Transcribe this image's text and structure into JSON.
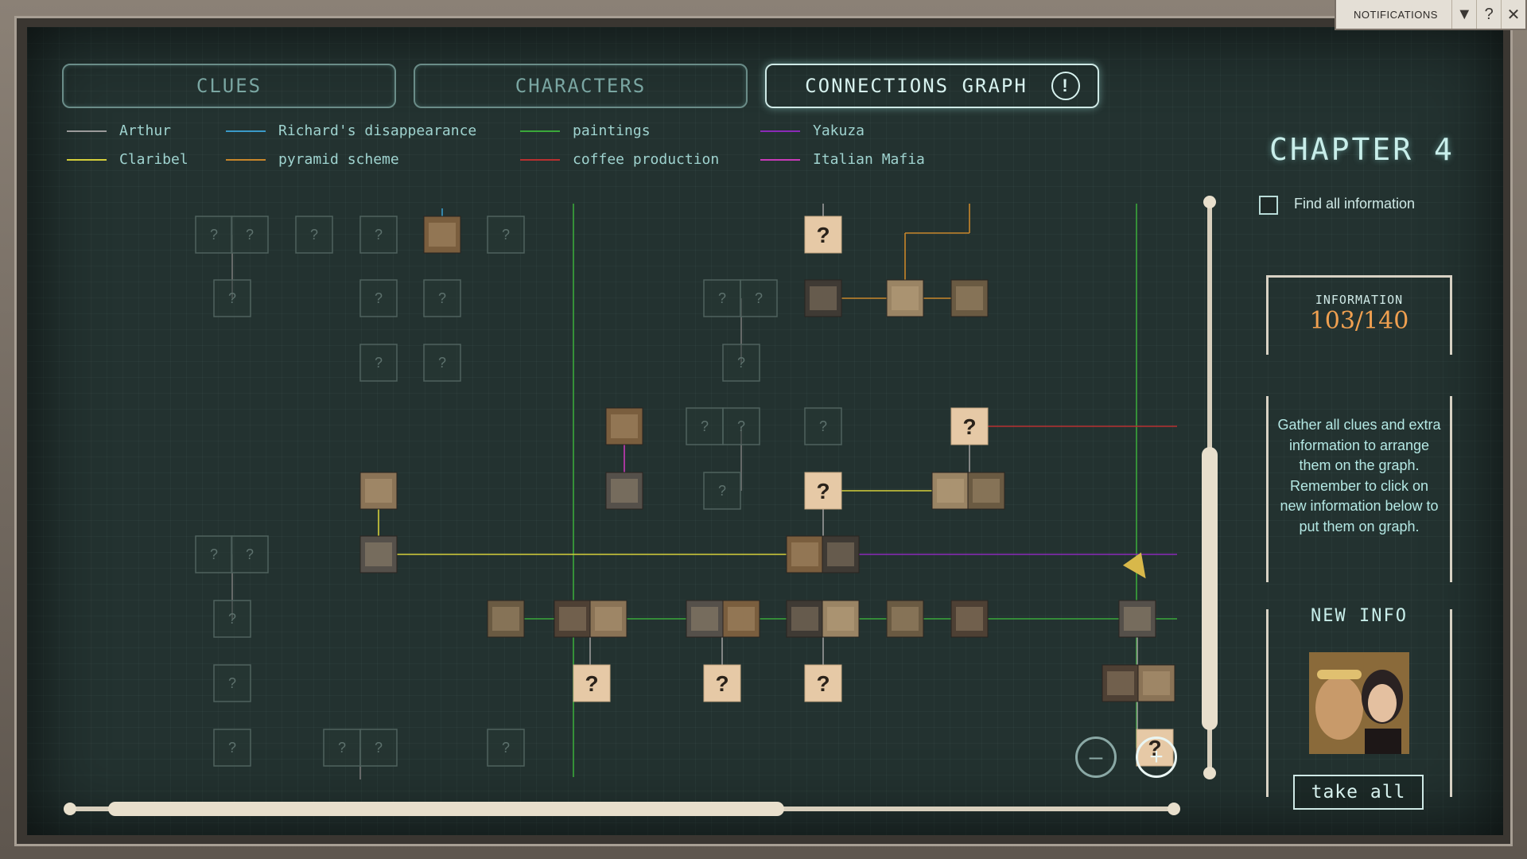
{
  "notifications": {
    "label": "NOTIFICATIONS",
    "dropdown_icon": "▼",
    "help_icon": "?",
    "close_icon": "✕"
  },
  "tabs": [
    {
      "label": "CLUES",
      "active": false
    },
    {
      "label": "CHARACTERS",
      "active": false
    },
    {
      "label": "CONNECTIONS GRAPH",
      "active": true,
      "badge": "!"
    }
  ],
  "legend": [
    {
      "label": "Arthur",
      "color": "#9a9a9a"
    },
    {
      "label": "Claribel",
      "color": "#d4cf3a"
    },
    {
      "label": "Richard's disappearance",
      "color": "#3a9ac8"
    },
    {
      "label": "pyramid scheme",
      "color": "#c8862a"
    },
    {
      "label": "paintings",
      "color": "#3aa83a"
    },
    {
      "label": "coffee production",
      "color": "#b83030"
    },
    {
      "label": "Yakuza",
      "color": "#8a2ab8"
    },
    {
      "label": "Italian Mafia",
      "color": "#c83ab8"
    }
  ],
  "chapter": "CHAPTER 4",
  "find_all": {
    "label": "Find all information",
    "checked": false
  },
  "information": {
    "title": "INFORMATION",
    "count": "103/140"
  },
  "hint": "Gather all clues and extra information to arrange them on the graph. Remember to click on new information below to put them on graph.",
  "new_info": {
    "title": "NEW INFO"
  },
  "take_all": "take all",
  "zoom": {
    "out": "–",
    "in": "+"
  },
  "graph": {
    "placeholder_glyph": "?",
    "nodes": [
      {
        "id": "a1",
        "type": "empty"
      },
      {
        "id": "a2",
        "type": "empty"
      },
      {
        "id": "a3",
        "type": "empty"
      },
      {
        "id": "a4",
        "type": "empty"
      },
      {
        "id": "a5",
        "type": "img"
      },
      {
        "id": "a6",
        "type": "empty"
      },
      {
        "id": "a7",
        "type": "unknown"
      },
      {
        "id": "b1",
        "type": "empty"
      },
      {
        "id": "b2",
        "type": "empty"
      },
      {
        "id": "b3",
        "type": "empty"
      },
      {
        "id": "b4",
        "type": "empty"
      },
      {
        "id": "b5",
        "type": "empty"
      },
      {
        "id": "b6",
        "type": "img"
      },
      {
        "id": "b7",
        "type": "img"
      },
      {
        "id": "b8",
        "type": "img"
      },
      {
        "id": "c1",
        "type": "empty"
      },
      {
        "id": "c2",
        "type": "empty"
      },
      {
        "id": "c3",
        "type": "empty"
      },
      {
        "id": "d1",
        "type": "img"
      },
      {
        "id": "d2",
        "type": "empty"
      },
      {
        "id": "d3",
        "type": "empty"
      },
      {
        "id": "d4",
        "type": "empty"
      },
      {
        "id": "d5",
        "type": "unknown"
      },
      {
        "id": "e1",
        "type": "img"
      },
      {
        "id": "e2",
        "type": "img"
      },
      {
        "id": "e3",
        "type": "empty"
      },
      {
        "id": "e4",
        "type": "unknown"
      },
      {
        "id": "e5",
        "type": "img"
      },
      {
        "id": "e6",
        "type": "img"
      },
      {
        "id": "f1",
        "type": "empty"
      },
      {
        "id": "f2",
        "type": "empty"
      },
      {
        "id": "f3",
        "type": "img"
      },
      {
        "id": "f4",
        "type": "img"
      },
      {
        "id": "f5",
        "type": "img"
      },
      {
        "id": "g1",
        "type": "empty"
      },
      {
        "id": "g2",
        "type": "img"
      },
      {
        "id": "g3",
        "type": "img"
      },
      {
        "id": "g4",
        "type": "img"
      },
      {
        "id": "g5",
        "type": "img"
      },
      {
        "id": "g6",
        "type": "img"
      },
      {
        "id": "g7",
        "type": "img"
      },
      {
        "id": "g8",
        "type": "img"
      },
      {
        "id": "g9",
        "type": "img"
      },
      {
        "id": "g10",
        "type": "img"
      },
      {
        "id": "g11",
        "type": "img"
      },
      {
        "id": "g12",
        "type": "img"
      },
      {
        "id": "h1",
        "type": "empty"
      },
      {
        "id": "h2",
        "type": "unknown"
      },
      {
        "id": "h3",
        "type": "unknown"
      },
      {
        "id": "h4",
        "type": "unknown"
      },
      {
        "id": "h5",
        "type": "img"
      },
      {
        "id": "h6",
        "type": "img"
      },
      {
        "id": "i1",
        "type": "empty"
      },
      {
        "id": "i2",
        "type": "empty"
      },
      {
        "id": "i3",
        "type": "empty"
      },
      {
        "id": "i4",
        "type": "empty"
      },
      {
        "id": "i5",
        "type": "unknown"
      }
    ]
  }
}
